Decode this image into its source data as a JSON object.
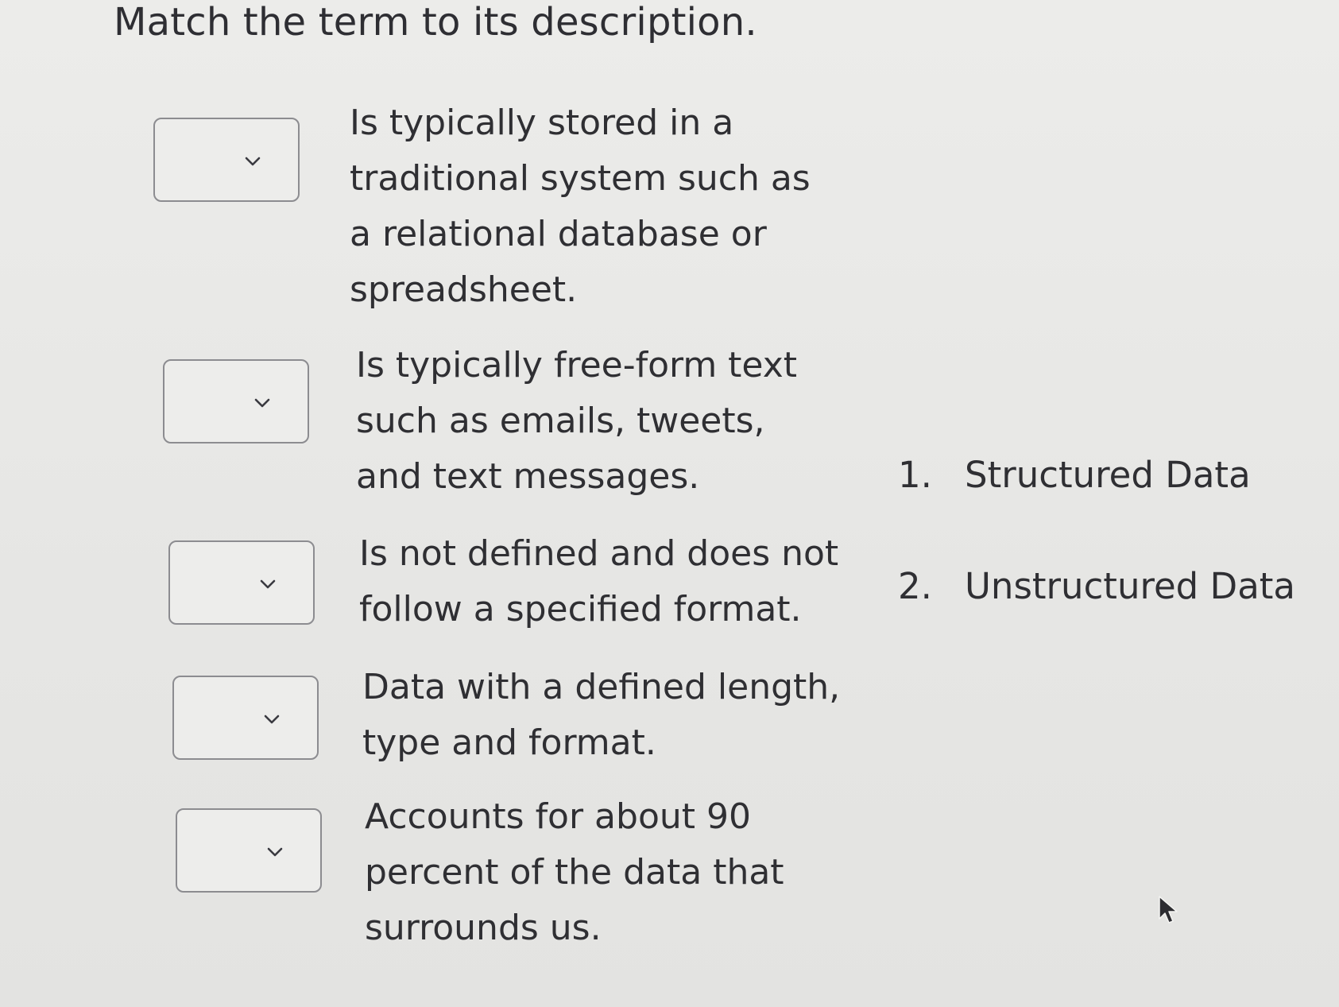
{
  "instruction": "Match the term to its description.",
  "rows": [
    {
      "description": "Is typically stored in a traditional system such as a relational database or spreadsheet.",
      "selected": ""
    },
    {
      "description": "Is typically free-form text such as emails, tweets, and text messages.",
      "selected": ""
    },
    {
      "description": "Is not defined and does not follow a specified format.",
      "selected": ""
    },
    {
      "description": "Data with a defined length, type and format.",
      "selected": ""
    },
    {
      "description": "Accounts for about 90 percent of the data that surrounds us.",
      "selected": ""
    }
  ],
  "terms": [
    {
      "number": "1.",
      "label": "Structured Data"
    },
    {
      "number": "2.",
      "label": "Unstructured Data"
    }
  ],
  "icons": {
    "dropdown": "chevron-down-icon",
    "cursor": "mouse-pointer-icon"
  }
}
